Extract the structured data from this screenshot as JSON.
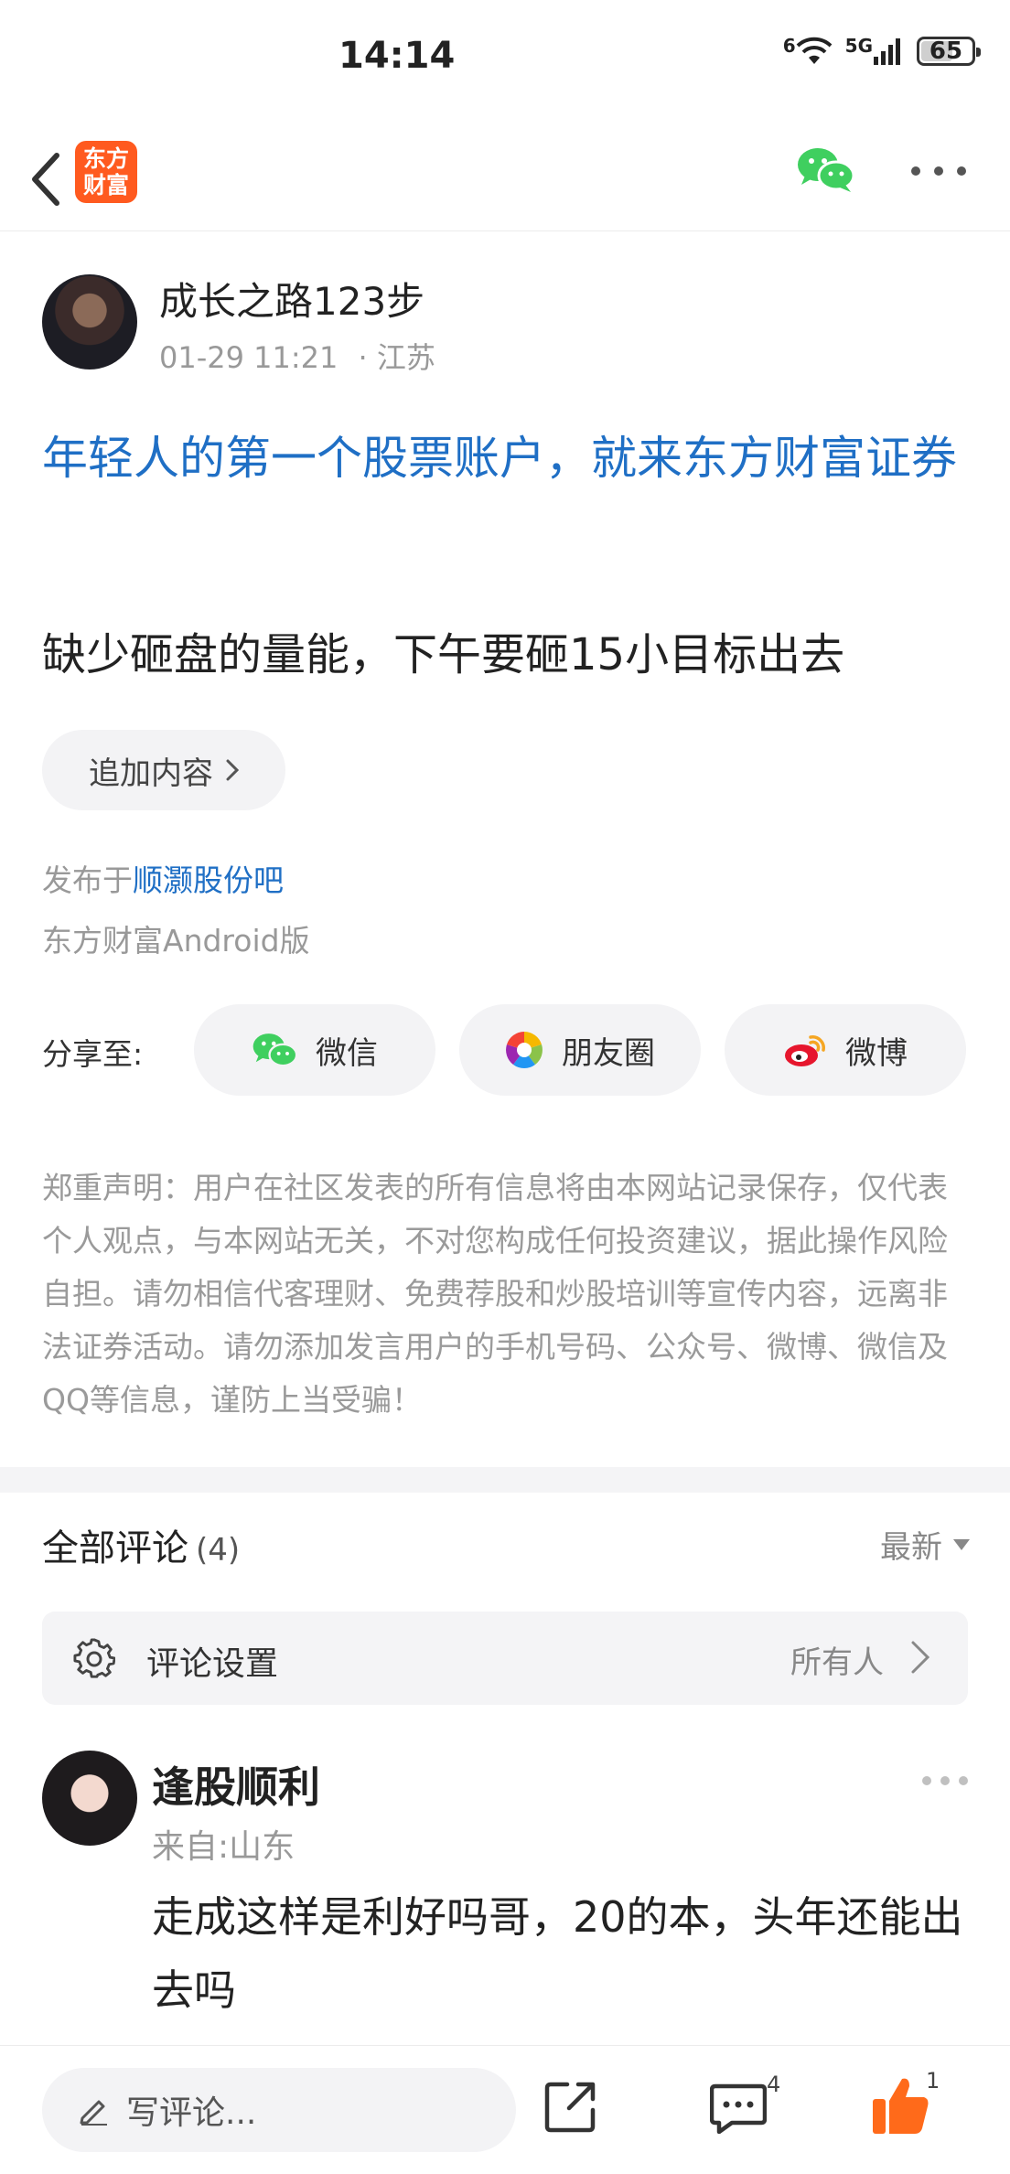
{
  "status_bar": {
    "time": "14:14",
    "network_wifi": "6",
    "network_cell": "5G",
    "battery": "65",
    "battery_level": 0.65
  },
  "app": {
    "logo_line1": "东方",
    "logo_line2": "财富",
    "accent": "#ff5a1f",
    "link_color": "#1f6fc5"
  },
  "post": {
    "author": "成长之路123步",
    "date": "01-29 11:21",
    "location": "· 江苏",
    "title": "年轻人的第一个股票账户，就来东方财富证券",
    "body": "缺少砸盘的量能，下午要砸15小目标出去",
    "add_content": "追加内容",
    "posted_in_prefix": "发布于",
    "posted_in_bar": "顺灏股份吧",
    "client": "东方财富Android版"
  },
  "share": {
    "label": "分享至:",
    "wechat": "微信",
    "moments": "朋友圈",
    "weibo": "微博"
  },
  "disclaimer": "郑重声明：用户在社区发表的所有信息将由本网站记录保存，仅代表个人观点，与本网站无关，不对您构成任何投资建议，据此操作风险自担。请勿相信代客理财、免费荐股和炒股培训等宣传内容，远离非法证券活动。请勿添加发言用户的手机号码、公众号、微博、微信及QQ等信息，谨防上当受骗！",
  "comments": {
    "header": "全部评论",
    "count": "(4)",
    "sort": "最新",
    "settings_label": "评论设置",
    "settings_value": "所有人",
    "items": [
      {
        "user": "逢股顺利",
        "from": "来自:山东",
        "text": "走成这样是利好吗哥，20的本，头年还能出去吗"
      }
    ]
  },
  "bottom_bar": {
    "placeholder": "写评论...",
    "comment_count": "4",
    "like_count": "1"
  }
}
